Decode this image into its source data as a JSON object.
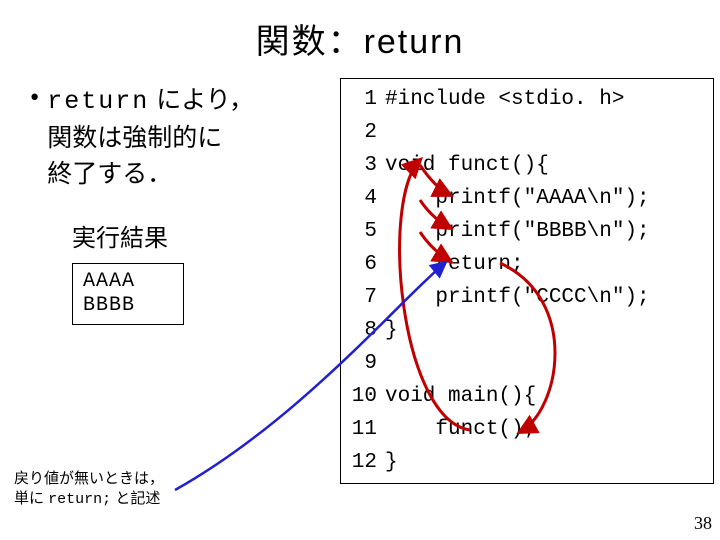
{
  "title": "関数：return",
  "bullet": {
    "marker": "•",
    "line1_prefix_mono": "return",
    "line1_rest": " により，",
    "line2": "関数は強制的に",
    "line3": "終了する．"
  },
  "result": {
    "label": "実行結果",
    "line1": "AAAA",
    "line2": "BBBB"
  },
  "footnote": {
    "line1": "戻り値が無いときは，",
    "line2_prefix": "単に ",
    "line2_mono": "return;",
    "line2_suffix": " と記述"
  },
  "code": [
    {
      "n": "1",
      "t": "#include <stdio. h>"
    },
    {
      "n": "2",
      "t": ""
    },
    {
      "n": "3",
      "t": "void funct(){"
    },
    {
      "n": "4",
      "t": "    printf(\"AAAA\\n\");"
    },
    {
      "n": "5",
      "t": "    printf(\"BBBB\\n\");"
    },
    {
      "n": "6",
      "t": "    return;"
    },
    {
      "n": "7",
      "t": "    printf(\"CCCC\\n\");"
    },
    {
      "n": "8",
      "t": "}"
    },
    {
      "n": "9",
      "t": ""
    },
    {
      "n": "10",
      "t": "void main(){"
    },
    {
      "n": "11",
      "t": "    funct();"
    },
    {
      "n": "12",
      "t": "}"
    }
  ],
  "page_number": "38"
}
